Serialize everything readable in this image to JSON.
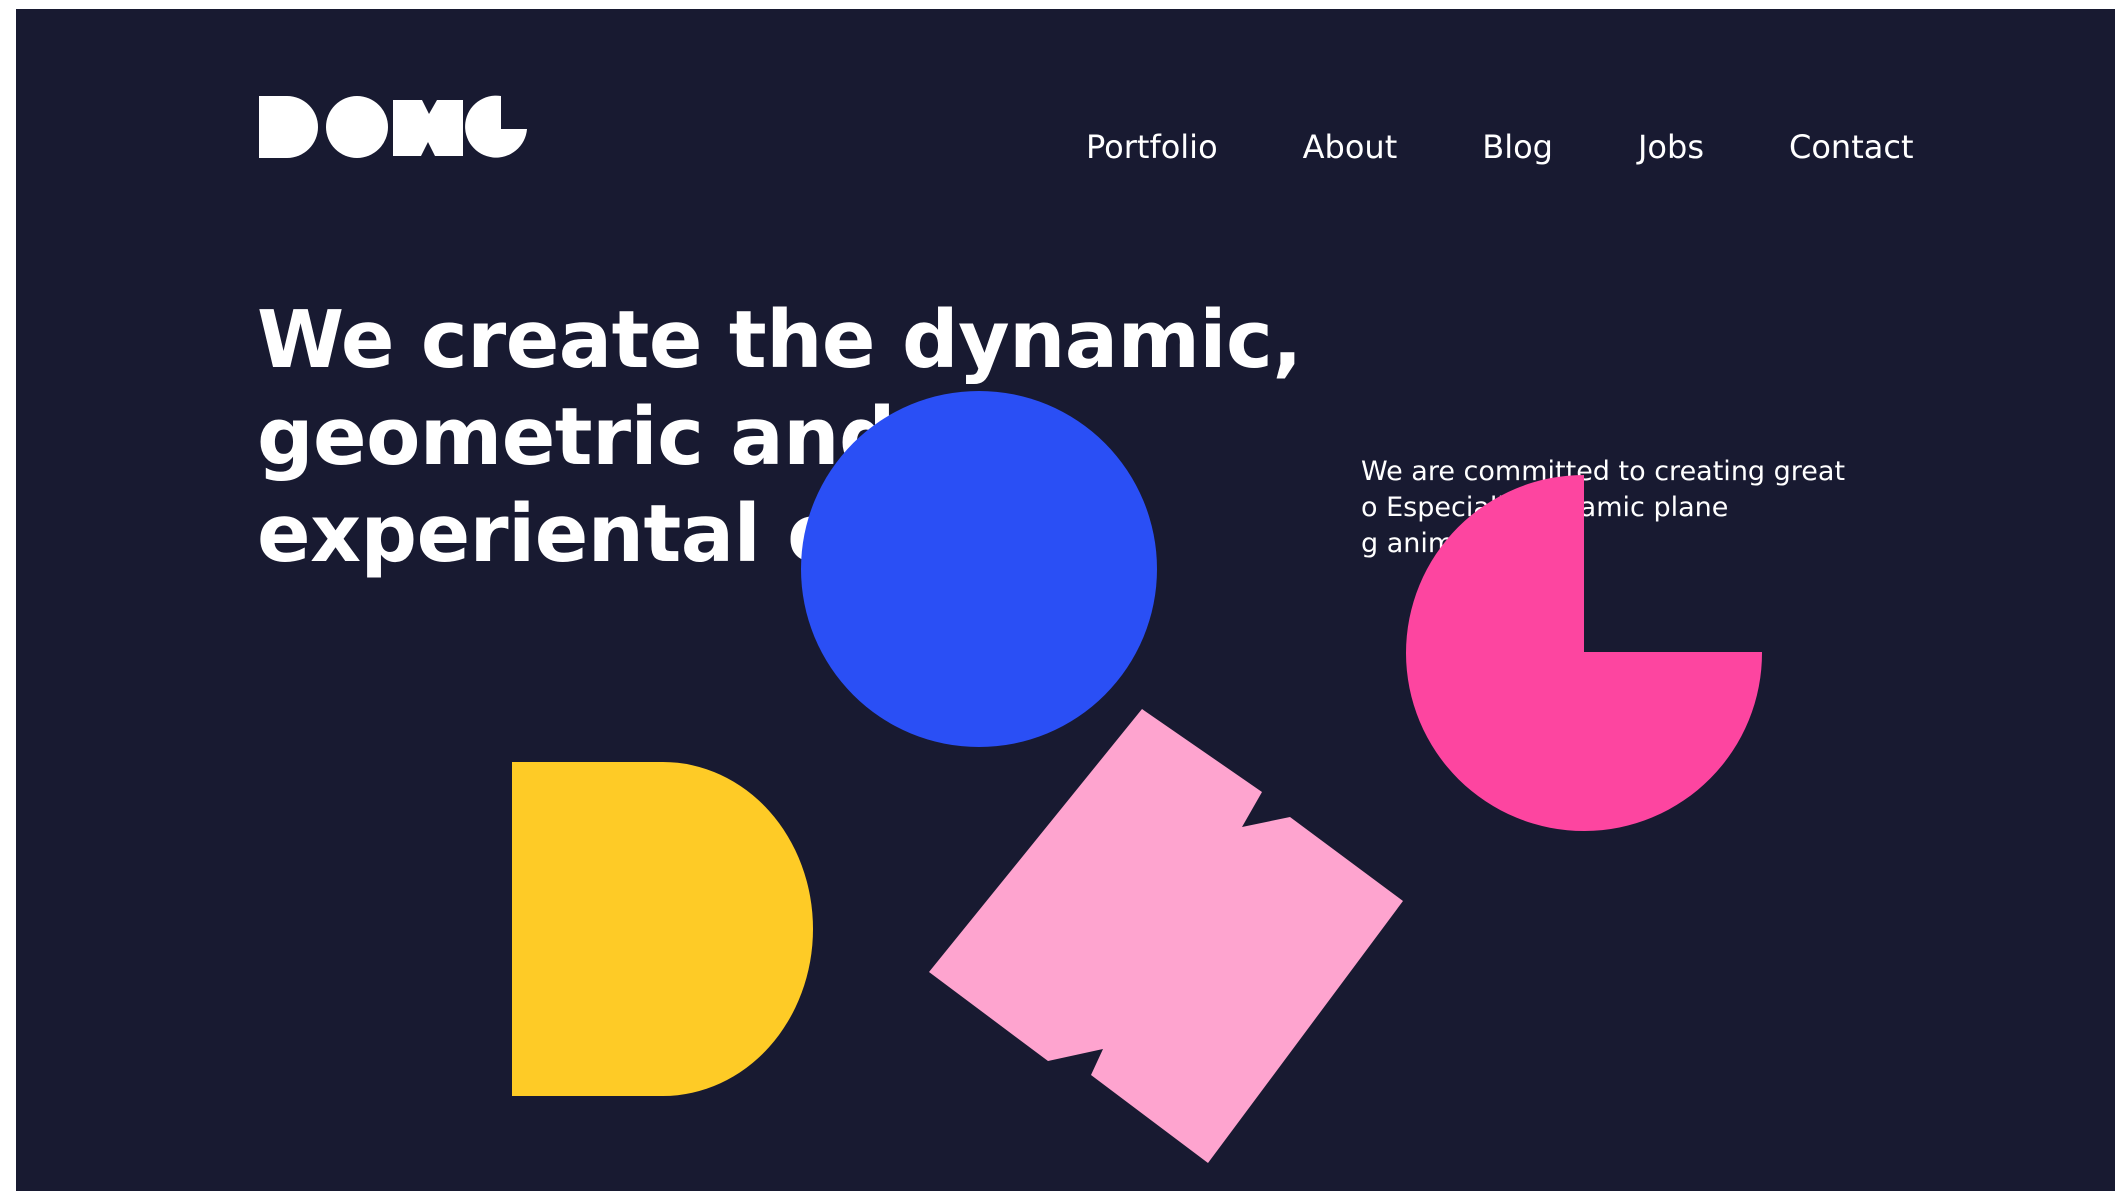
{
  "brand": {
    "logo_text": "DONG",
    "colors": {
      "background": "#181a31",
      "text": "#ffffff",
      "blue": "#2a4ff5",
      "magenta": "#fd45a0",
      "yellow": "#fecb26",
      "pink": "#fea4cf"
    }
  },
  "nav": {
    "items": [
      {
        "label": "Portfolio"
      },
      {
        "label": "About"
      },
      {
        "label": "Blog"
      },
      {
        "label": "Jobs"
      },
      {
        "label": "Contact"
      }
    ]
  },
  "hero": {
    "headline_lines": [
      "We create the dynamic,",
      "geometric and",
      "experiental es"
    ],
    "intro_lines": [
      "We are committed to creating great",
      "o Especially dynamic plane",
      "g animation."
    ]
  },
  "shapes": [
    {
      "name": "letter-d-shape",
      "color": "yellow"
    },
    {
      "name": "letter-o-shape",
      "color": "blue"
    },
    {
      "name": "letter-n-shape",
      "color": "pink"
    },
    {
      "name": "letter-g-shape",
      "color": "magenta"
    }
  ]
}
